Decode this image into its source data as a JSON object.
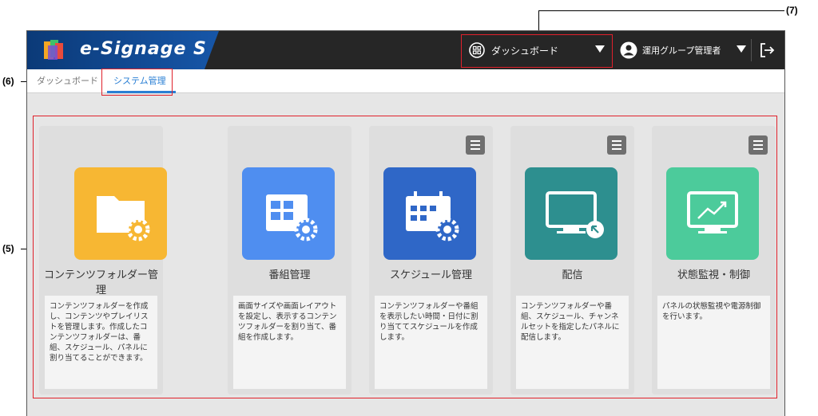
{
  "app": {
    "title": "e-Signage S"
  },
  "header": {
    "dashboard_select": {
      "label": "ダッシュボード",
      "icon": "grid-circle-icon"
    },
    "user": {
      "label": "運用グループ管理者",
      "icon": "user-circle-icon"
    },
    "logout_icon": "logout-icon"
  },
  "tabs": [
    {
      "label": "ダッシュボード"
    },
    {
      "label": "システム管理"
    }
  ],
  "cards": [
    {
      "title": "コンテンツフォルダー管理",
      "desc": "コンテンツフォルダーを作成し、コンテンツやプレイリストを管理します。作成したコンテンツフォルダーは、番組、スケジュール、パネルに割り当てることができます。",
      "color": "#f7b733",
      "icon": "folder-gear-icon"
    },
    {
      "title": "番組管理",
      "desc": "画面サイズや画面レイアウトを設定し、表示するコンテンツフォルダーを割り当て、番組を作成します。",
      "color": "#4f8ef0",
      "icon": "layout-gear-icon"
    },
    {
      "title": "スケジュール管理",
      "desc": "コンテンツフォルダーや番組を表示したい時間・日付に割り当ててスケジュールを作成します。",
      "color": "#2f67c7",
      "icon": "calendar-gear-icon"
    },
    {
      "title": "配信",
      "desc": "コンテンツフォルダーや番組、スケジュール、チャンネルセットを指定したパネルに配信します。",
      "color": "#2d8f8f",
      "icon": "monitor-send-icon"
    },
    {
      "title": "状態監視・制御",
      "desc": "パネルの状態監視や電源制御を行います。",
      "color": "#4ccb9b",
      "icon": "monitor-chart-icon"
    }
  ],
  "callouts": {
    "c5": "(5)",
    "c6": "(6)",
    "c7": "(7)"
  },
  "colors": {
    "highlight": "#e0212b",
    "topbar": "#262626",
    "accent": "#2a7fd4"
  }
}
